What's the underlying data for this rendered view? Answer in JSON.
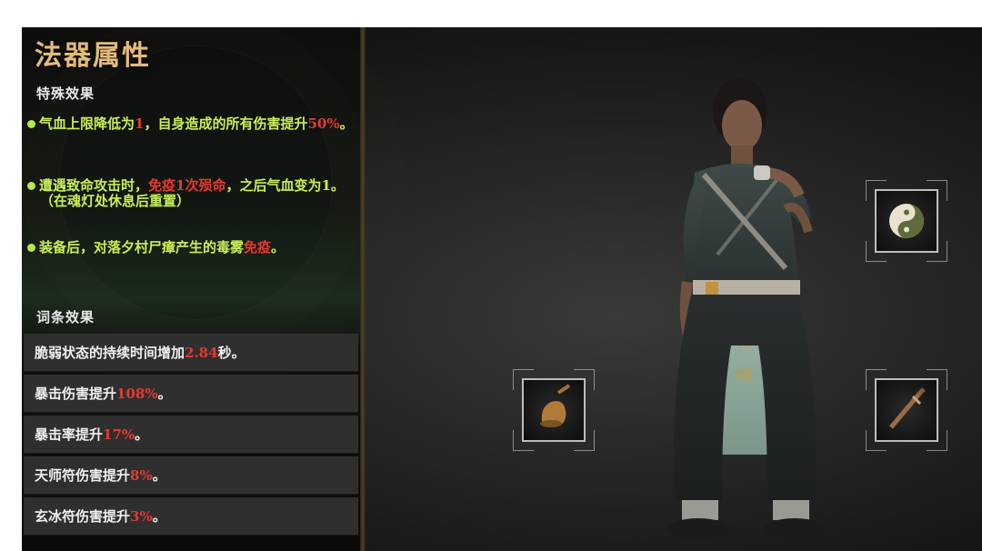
{
  "panel": {
    "title": "法器属性",
    "special_label": "特殊效果",
    "affix_label": "词条效果"
  },
  "effects": {
    "e1": {
      "a": "气血上限降低为",
      "b": "1",
      "c": "，自身造成的所有伤害提升",
      "d": "50%",
      "e": "。"
    },
    "e2": {
      "a": "遭遇致命攻击时，",
      "b": "免疫1次殒命",
      "c": "，之后气血变为1。",
      "note": "（在魂灯处休息后重置）"
    },
    "e3": {
      "a": "装备后，对落夕村尸瘴产生的毒雾",
      "b": "免疫",
      "c": "。"
    }
  },
  "affixes": [
    {
      "pre": "脆弱状态的持续时间增加",
      "val": "2.84",
      "post": "秒。"
    },
    {
      "pre": "暴击伤害提升",
      "val": "108%",
      "post": "。"
    },
    {
      "pre": "暴击率提升",
      "val": "17%",
      "post": "。"
    },
    {
      "pre": "天师符伤害提升",
      "val": "8%",
      "post": "。"
    },
    {
      "pre": "玄冰符伤害提升",
      "val": "3%",
      "post": "。"
    }
  ],
  "icons": {
    "slot1": "yin-yang-icon",
    "slot2": "bell-icon",
    "slot3": "sword-icon"
  },
  "colors": {
    "title": "#e4bb7a",
    "effect_text": "#c9f056",
    "highlight": "#e53a2e"
  }
}
